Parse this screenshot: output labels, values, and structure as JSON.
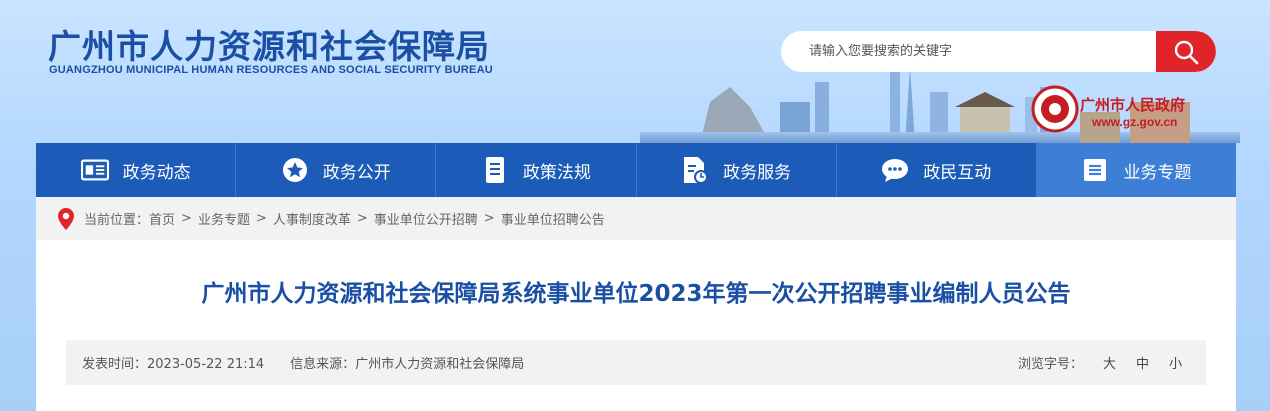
{
  "header": {
    "title": "广州市人力资源和社会保障局",
    "subtitle": "GUANGZHOU MUNICIPAL HUMAN RESOURCES AND SOCIAL SECURITY BUREAU",
    "search_placeholder": "请输入您要搜索的关键字",
    "gov_name": "广州市人民政府",
    "gov_url": "www.gz.gov.cn"
  },
  "nav": {
    "items": [
      {
        "label": "政务动态",
        "icon": "newspaper-icon"
      },
      {
        "label": "政务公开",
        "icon": "star-icon"
      },
      {
        "label": "政策法规",
        "icon": "document-icon"
      },
      {
        "label": "政务服务",
        "icon": "service-doc-icon"
      },
      {
        "label": "政民互动",
        "icon": "chat-icon"
      },
      {
        "label": "业务专题",
        "icon": "list-icon",
        "active": true
      }
    ]
  },
  "breadcrumb": {
    "prefix": "当前位置：",
    "items": [
      "首页",
      "业务专题",
      "人事制度改革",
      "事业单位公开招聘",
      "事业单位招聘公告"
    ],
    "separator": ">"
  },
  "article": {
    "title": "广州市人力资源和社会保障局系统事业单位2023年第一次公开招聘事业编制人员公告",
    "publish_label": "发表时间：",
    "publish_time": "2023-05-22 21:14",
    "source_label": "信息来源：",
    "source": "广州市人力资源和社会保障局",
    "font_size_label": "浏览字号：",
    "font_sizes": [
      "大",
      "中",
      "小"
    ]
  },
  "colors": {
    "brand_blue": "#1a4fa3",
    "nav_blue": "#1c5bb8",
    "accent_red": "#e0252a"
  }
}
